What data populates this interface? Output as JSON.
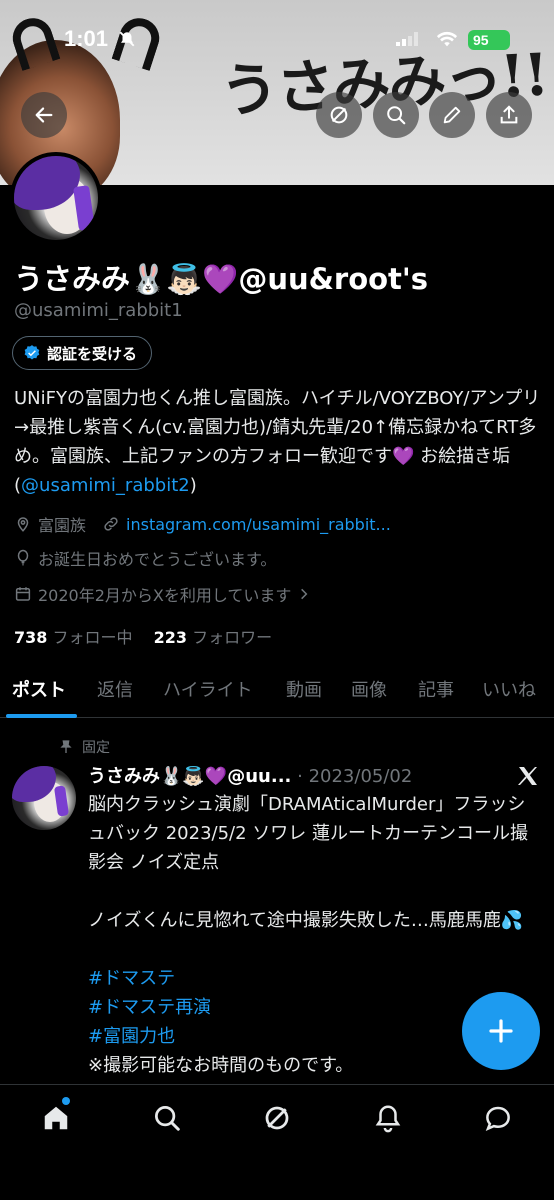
{
  "status_bar": {
    "time": "1:01",
    "battery": "95"
  },
  "banner": {
    "title_text": "うさみみっ!!"
  },
  "profile": {
    "name": "うさみみ🐰👼🏻💜@uu&root's",
    "handle": "@usamimi_rabbit1",
    "verify_button_label": "認証を受ける",
    "bio_text": "UNiFYの富園力也くん推し富園族。ハイチル/VOYZBOY/アンプリ→最推し紫音くん(cv.富園力也)/錆丸先輩/20↑備忘録かねてRT多め。富園族、上記ファンの方フォロー歓迎です💜 お絵描き垢 (",
    "bio_link": "@usamimi_rabbit2",
    "bio_end": ")",
    "location": "富園族",
    "website": "instagram.com/usamimi_rabbit...",
    "birthday": "お誕生日おめでとうございます。",
    "joined": "2020年2月からXを利用しています",
    "following_count": "738",
    "following_label": "フォロー中",
    "followers_count": "223",
    "followers_label": "フォロワー"
  },
  "tabs": [
    {
      "label": "ポスト",
      "active": true
    },
    {
      "label": "返信"
    },
    {
      "label": "ハイライト"
    },
    {
      "label": "動画"
    },
    {
      "label": "画像"
    },
    {
      "label": "記事"
    },
    {
      "label": "いいね"
    }
  ],
  "post": {
    "pinned_label": "固定",
    "author": "うさみみ🐰👼🏻💜@uu...",
    "date": "· 2023/05/02",
    "body_line1": "脳内クラッシュ演劇「DRAMAticalMurder」フラッシュバック 2023/5/2 ソワレ 蓮ルートカーテンコール撮影会 ノイズ定点",
    "body_line2": "ノイズくんに見惚れて途中撮影失敗した…馬鹿馬鹿💦",
    "hashtags": [
      "#ドマステ",
      "#ドマステ再演",
      "#富園力也"
    ],
    "body_line3": "※撮影可能なお時間のものです。"
  },
  "colors": {
    "accent": "#1d9bf0",
    "background": "#000000",
    "muted": "#71767b"
  },
  "icons": {
    "banner_buttons": [
      "back-arrow-icon",
      "grok-icon",
      "search-icon",
      "edit-pencil-icon",
      "share-icon"
    ],
    "bottom_nav": [
      "home-icon",
      "search-icon",
      "grok-icon",
      "notifications-icon",
      "messages-icon"
    ]
  }
}
